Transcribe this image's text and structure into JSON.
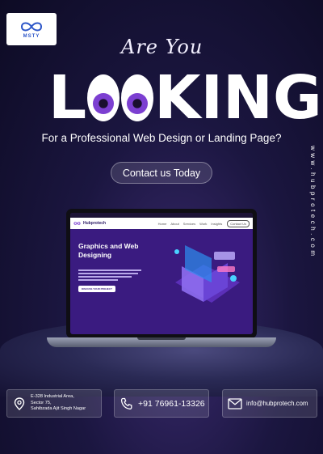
{
  "brand": {
    "logo_text": "MSTY"
  },
  "headline": {
    "line1": "Are You",
    "looking_first": "L",
    "looking_rest": "KING",
    "subtitle": "For a Professional Web Design or Landing Page?"
  },
  "cta": {
    "label": "Contact us Today"
  },
  "website": "www.hubprotech.com",
  "laptop_site": {
    "brand": "Hubprotech",
    "nav": [
      "Home",
      "About",
      "Services",
      "Work",
      "Insights"
    ],
    "nav_button": "Contact Us",
    "hero_title_line1": "Graphics and Web",
    "hero_title_line2": "Designing",
    "hero_button": "DISCUSS YOUR PROJECT"
  },
  "contact": {
    "address_line1": "E-328 Industrial Area,",
    "address_line2": "Sector 75,",
    "address_line3": "Sahibzada Ajit Singh Nagar",
    "phone": "+91 76961-13326",
    "email": "info@hubprotech.com"
  },
  "colors": {
    "background": "#1b1640",
    "accent_purple": "#7c3fd1",
    "logo_blue": "#2d56c8"
  },
  "icons": [
    "infinity-logo-icon",
    "location-pin-icon",
    "phone-icon",
    "mail-icon"
  ]
}
